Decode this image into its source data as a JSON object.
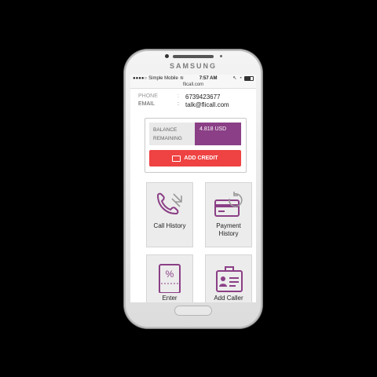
{
  "device": {
    "brand": "SAMSUNG"
  },
  "statusbar": {
    "carrier": "Simple Mobile",
    "time": "7:57 AM"
  },
  "urlbar": {
    "url": "flicall.com"
  },
  "account": {
    "phone_label": "PHONE",
    "phone_value": "6739423677",
    "email_label": "EMAIL",
    "colon": ":",
    "email_value": "talk@flicall.com"
  },
  "balance": {
    "label": "BALANCE REMAINING",
    "value": "4.818 USD",
    "add_credit_label": "ADD CREDIT"
  },
  "tiles": [
    {
      "label": "Call History",
      "icon": "phone-arrows-icon"
    },
    {
      "label": "Payment History",
      "icon": "card-refresh-icon"
    },
    {
      "label": "Enter",
      "icon": "voucher-percent-icon"
    },
    {
      "label": "Add Caller",
      "icon": "id-briefcase-icon"
    }
  ],
  "colors": {
    "accent_purple": "#8b3f86",
    "button_red": "#ee4342"
  }
}
